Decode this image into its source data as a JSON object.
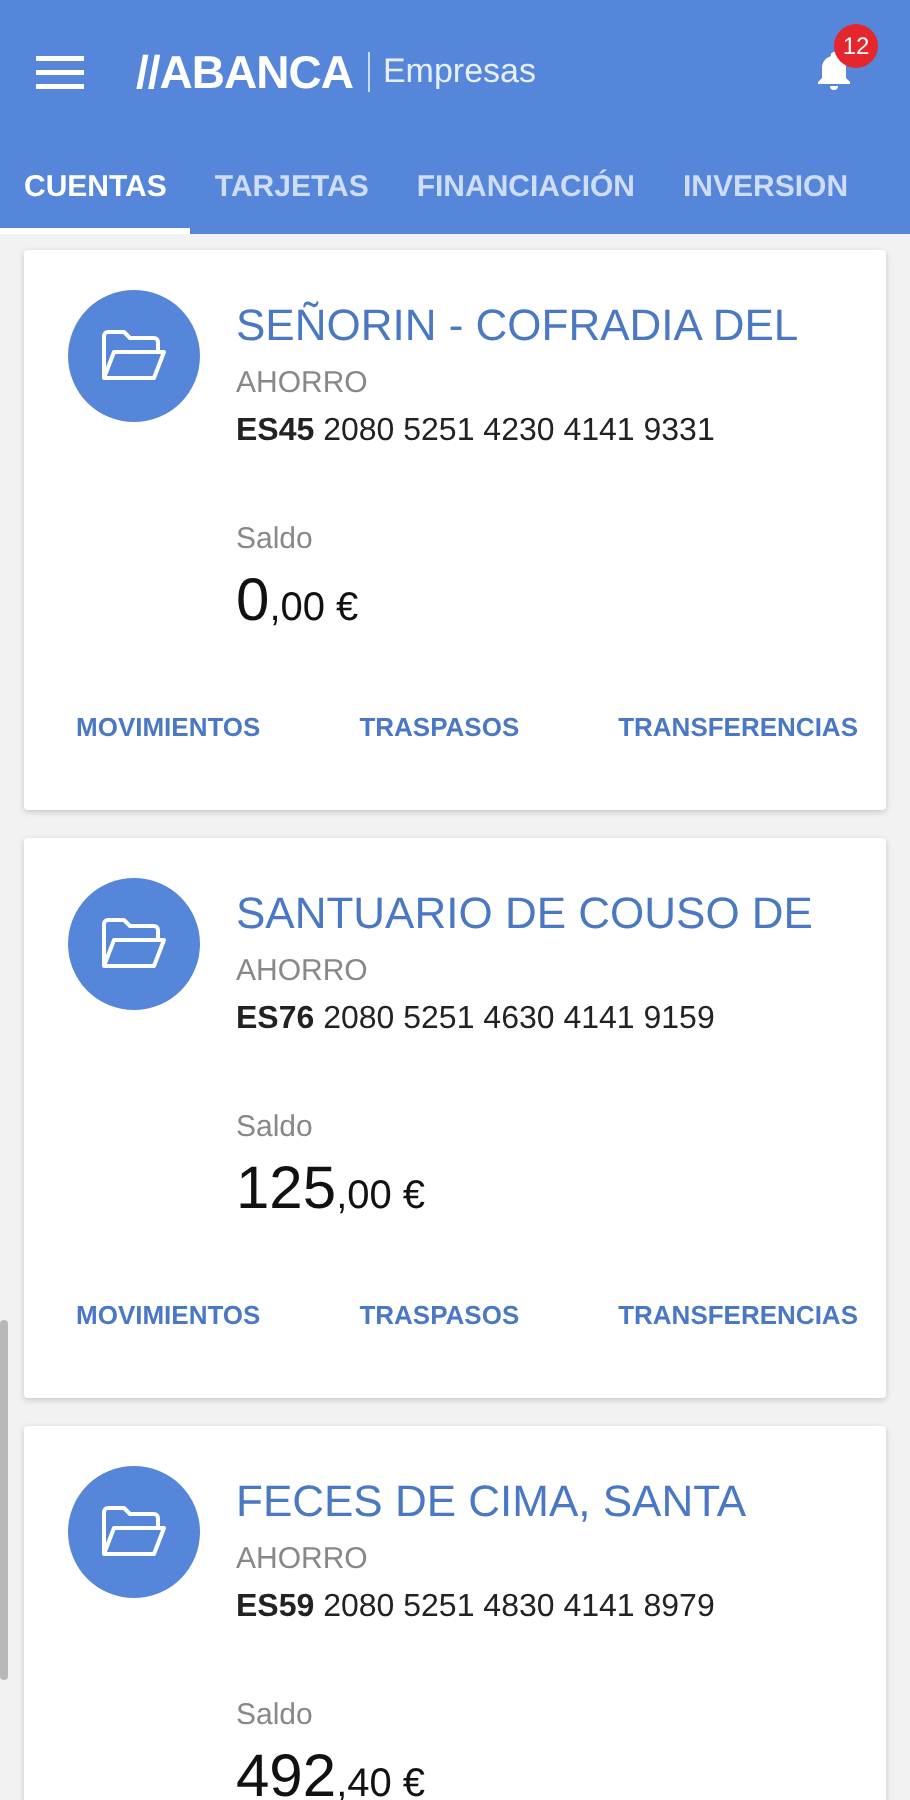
{
  "header": {
    "brand": "//ABANCA",
    "section": "Empresas",
    "notifications": "12"
  },
  "tabs": [
    {
      "label": "CUENTAS",
      "selected": true
    },
    {
      "label": "TARJETAS",
      "selected": false
    },
    {
      "label": "FINANCIACIÓN",
      "selected": false
    },
    {
      "label": "INVERSION",
      "selected": false
    }
  ],
  "accounts": [
    {
      "name": "SEÑORIN - COFRADIA DEL",
      "type": "AHORRO",
      "iban_prefix": "ES45",
      "iban": "2080 5251 4230 4141 9331",
      "balance_label": "Saldo",
      "balance_int": "0",
      "balance_dec": ",00 €",
      "actions": [
        "MOVIMIENTOS",
        "TRASPASOS",
        "TRANSFERENCIAS"
      ]
    },
    {
      "name": "SANTUARIO DE COUSO DE",
      "type": "AHORRO",
      "iban_prefix": "ES76",
      "iban": "2080 5251 4630 4141 9159",
      "balance_label": "Saldo",
      "balance_int": "125",
      "balance_dec": ",00 €",
      "actions": [
        "MOVIMIENTOS",
        "TRASPASOS",
        "TRANSFERENCIAS"
      ]
    },
    {
      "name": "FECES DE CIMA, SANTA",
      "type": "AHORRO",
      "iban_prefix": "ES59",
      "iban": "2080 5251 4830 4141 8979",
      "balance_label": "Saldo",
      "balance_int": "492",
      "balance_dec": ",40 €"
    }
  ]
}
